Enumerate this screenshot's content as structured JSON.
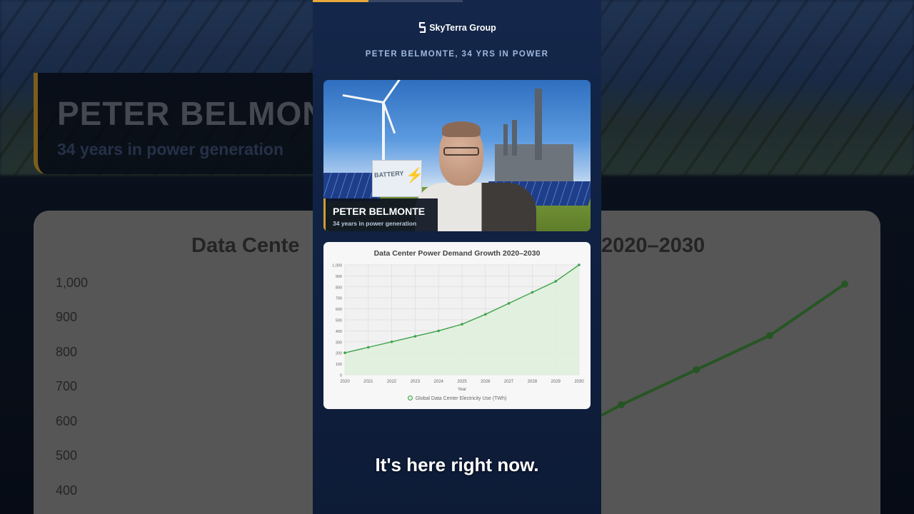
{
  "brand": {
    "name": "SkyTerra Group",
    "logo_icon": "skyterra-logo-icon"
  },
  "kicker": "PETER BELMONTE, 34 YRS IN POWER",
  "lower_third": {
    "name": "PETER BELMONTE",
    "subtitle": "34 years in power generation"
  },
  "background": {
    "lower_third_name": "PETER BELMONTE",
    "lower_third_sub": "34 years in power generation",
    "chart_title_left": "Data Cente",
    "chart_title_right": "2020–2030",
    "y_labels": [
      "1,000",
      "900",
      "800",
      "700",
      "600",
      "500",
      "400"
    ]
  },
  "video_scene": {
    "battery_label": "BATTERY"
  },
  "playback": {
    "progress": 0.37
  },
  "caption": "It's here right now.",
  "colors": {
    "accent": "#d29a33",
    "line": "#3fa34d",
    "fill": "#dff0dc"
  },
  "chart_data": {
    "type": "area",
    "title": "Data Center Power Demand Growth 2020–2030",
    "xlabel": "Year",
    "ylabel": "",
    "x": [
      "2020",
      "2021",
      "2022",
      "2023",
      "2024",
      "2025",
      "2026",
      "2027",
      "2028",
      "2029",
      "2030"
    ],
    "ylim": [
      0,
      1000
    ],
    "yticks": [
      "0",
      "100",
      "200",
      "300",
      "400",
      "500",
      "600",
      "700",
      "800",
      "900",
      "1,000"
    ],
    "grid": true,
    "legend_position": "bottom",
    "series": [
      {
        "name": "Global Data Center Electricity Use (TWh)",
        "values": [
          200,
          250,
          300,
          350,
          400,
          460,
          550,
          650,
          750,
          850,
          1000
        ]
      }
    ]
  }
}
